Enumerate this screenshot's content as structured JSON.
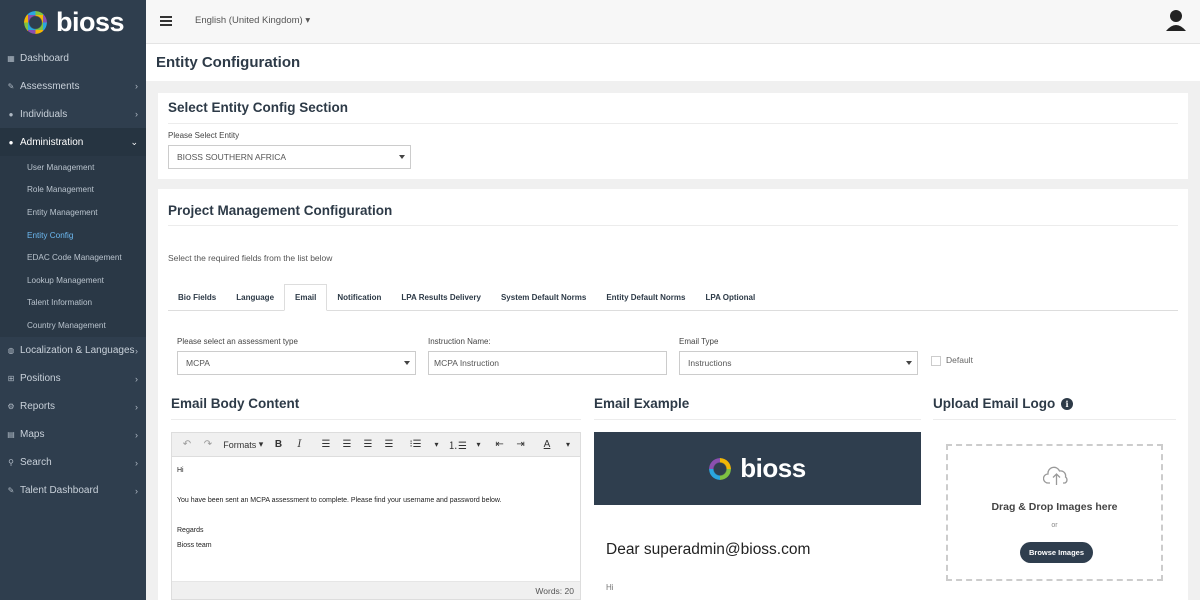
{
  "brand": {
    "name": "bioss"
  },
  "sidebar": {
    "items": [
      {
        "label": "Dashboard",
        "icon": "dashboard-icon",
        "chevron": false
      },
      {
        "label": "Assessments",
        "icon": "edit-icon",
        "chevron": true
      },
      {
        "label": "Individuals",
        "icon": "users-icon",
        "chevron": true
      },
      {
        "label": "Administration",
        "icon": "user-icon",
        "chevron": true,
        "expanded": true
      }
    ],
    "submenu": [
      "User Management",
      "Role Management",
      "Entity Management",
      "Entity Config",
      "EDAC Code Management",
      "Lookup Management",
      "Talent Information",
      "Country Management"
    ],
    "items_after": [
      {
        "label": "Localization & Languages",
        "icon": "globe-icon"
      },
      {
        "label": "Positions",
        "icon": "sitemap-icon"
      },
      {
        "label": "Reports",
        "icon": "gears-icon"
      },
      {
        "label": "Maps",
        "icon": "map-icon"
      },
      {
        "label": "Search",
        "icon": "search-icon"
      },
      {
        "label": "Talent Dashboard",
        "icon": "edit-icon"
      }
    ],
    "current_submenu": "Entity Config"
  },
  "topbar": {
    "language": "English (United Kingdom)"
  },
  "page": {
    "title": "Entity Configuration"
  },
  "entity_section": {
    "title": "Select Entity Config Section",
    "label": "Please Select Entity",
    "selected": "BIOSS SOUTHERN AFRICA"
  },
  "pm_section": {
    "title": "Project Management Configuration",
    "hint": "Select the required fields from the list below",
    "tabs": [
      "Bio Fields",
      "Language",
      "Email",
      "Notification",
      "LPA Results Delivery",
      "System Default Norms",
      "Entity Default Norms",
      "LPA Optional"
    ],
    "active_tab": "Email"
  },
  "email_form": {
    "assessment_label": "Please select an assessment type",
    "assessment_value": "MCPA",
    "instruction_label": "Instruction Name:",
    "instruction_value": "MCPA Instruction",
    "email_type_label": "Email Type",
    "email_type_value": "Instructions",
    "default_label": "Default"
  },
  "email_body": {
    "title": "Email Body Content",
    "formats_label": "Formats",
    "lines": [
      "Hi",
      "",
      "You have been sent an MCPA assessment to complete. Please find your username and password below.",
      "",
      "Regards",
      "Bioss team"
    ],
    "word_count": "Words: 20"
  },
  "email_example": {
    "title": "Email Example",
    "brand": "bioss",
    "greeting": "Dear superadmin@bioss.com",
    "hi": "Hi"
  },
  "upload": {
    "title": "Upload Email Logo",
    "drop_text": "Drag & Drop Images here",
    "or_text": "or",
    "browse_label": "Browse Images"
  },
  "colors": {
    "sidebar": "#2f3e4e",
    "accent_link": "#6cb8f0",
    "heading": "#2d3a47"
  }
}
